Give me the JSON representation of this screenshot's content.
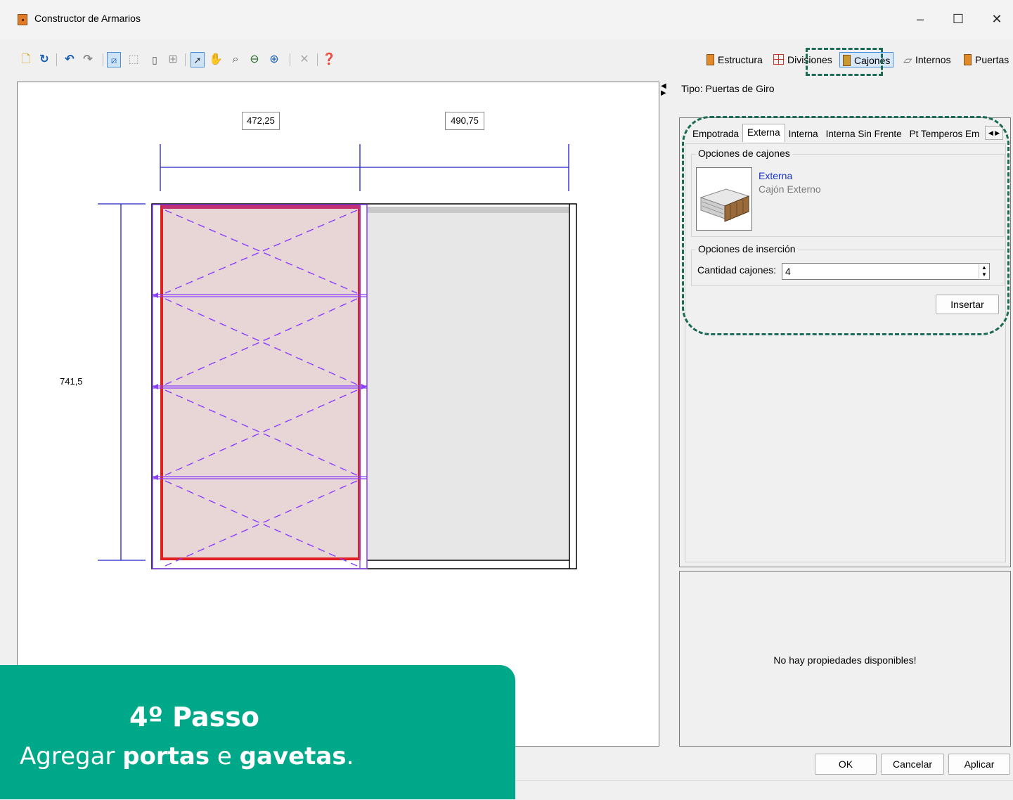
{
  "window": {
    "title": "Constructor de Armarios",
    "minimize": "–",
    "maximize": "☐",
    "close": "✕"
  },
  "toolbar": {
    "left_icons": [
      "new-icon",
      "refresh-icon",
      "undo-icon",
      "redo-icon",
      "select-region-icon",
      "rect-select-icon",
      "panel-icon",
      "grid-icon",
      "pointer-icon",
      "pan-icon",
      "zoom-fit-icon",
      "zoom-out-icon",
      "zoom-in-icon",
      "delete-icon",
      "help-icon"
    ],
    "right_tabs": [
      {
        "label": "Estructura",
        "icon": "wood-panel-icon"
      },
      {
        "label": "Divisiones",
        "icon": "grid-red-icon"
      },
      {
        "label": "Cajones",
        "icon": "drawer-icon"
      },
      {
        "label": "Internos",
        "icon": "shelf-icon"
      },
      {
        "label": "Puertas",
        "icon": "door-icon"
      }
    ]
  },
  "drawing": {
    "dim_top_left": "472,25",
    "dim_top_right": "490,75",
    "dim_left_height": "741,5"
  },
  "panel": {
    "tipo": "Tipo: Puertas de Giro",
    "tabs": [
      "Empotrada",
      "Externa",
      "Interna",
      "Interna Sin Frente",
      "Pt Temperos Em"
    ],
    "active_tab": "Externa",
    "group_drawer": "Opciones de cajones",
    "drawer_name": "Externa",
    "drawer_desc": "Cajón Externo",
    "group_insert": "Opciones de inserción",
    "qty_label": "Cantidad cajones:",
    "qty_value": "4",
    "insert_button": "Insertar",
    "properties_empty": "No hay propiedades disponibles!"
  },
  "buttons": {
    "ok": "OK",
    "cancel": "Cancelar",
    "apply": "Aplicar"
  },
  "callout": {
    "title": "4º Passo",
    "body_1": "Agregar ",
    "body_bold_1": "portas",
    "body_2": " e ",
    "body_bold_2": "gavetas",
    "body_3": "."
  },
  "colors": {
    "accent_green": "#00a88a",
    "highlight_dash": "#1c6b56",
    "selection_red": "#e02020",
    "dimension_blue": "#2020cc",
    "drawer_purple": "#8a3fff"
  }
}
